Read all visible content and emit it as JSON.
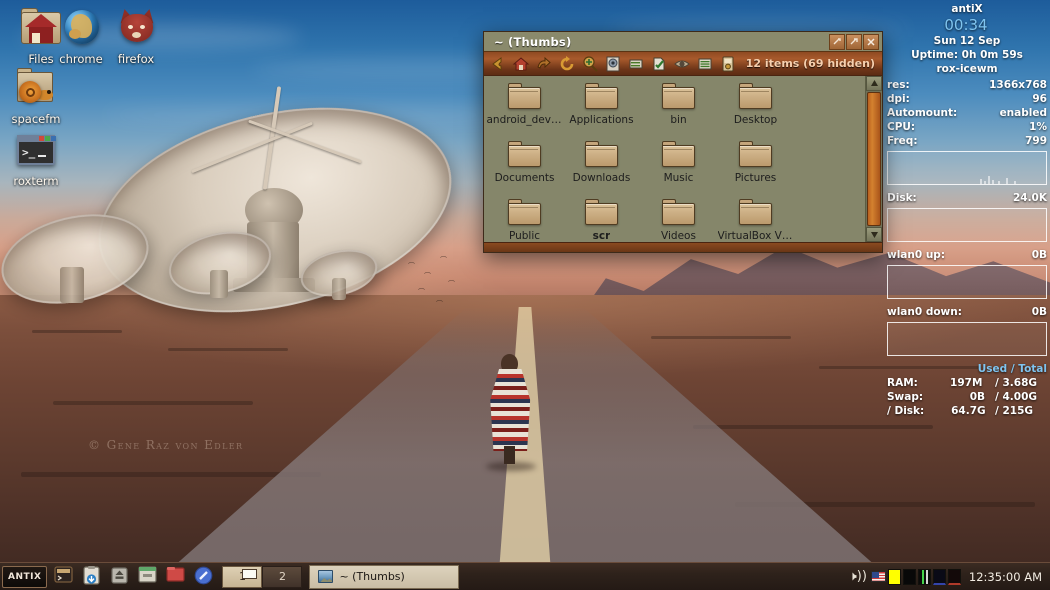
{
  "desktop": {
    "wallpaper_credit": "© Gene Raz von Edler",
    "icons": [
      {
        "name": "Files",
        "icon": "folder-home-icon"
      },
      {
        "name": "chrome",
        "icon": "globe-icon"
      },
      {
        "name": "firefox",
        "icon": "fox-head-icon"
      },
      {
        "name": "spacefm",
        "icon": "snail-box-icon"
      },
      {
        "name": "roxterm",
        "icon": "terminal-icon"
      }
    ]
  },
  "conky": {
    "distro": "antiX",
    "clock": "00:34",
    "date": "Sun 12 Sep",
    "uptime": "Uptime: 0h 0m 59s",
    "session": "rox-icewm",
    "stats": [
      {
        "label": "res:",
        "value": "1366x768"
      },
      {
        "label": "dpi:",
        "value": "96"
      },
      {
        "label": "Automount:",
        "value": "enabled"
      },
      {
        "label": "CPU:",
        "value": "1%"
      },
      {
        "label": "Freq:",
        "value": "799"
      }
    ],
    "meters": [
      {
        "label": "Disk:",
        "value": "24.0K"
      },
      {
        "label": "wlan0 up:",
        "value": "0B"
      },
      {
        "label": "wlan0 down:",
        "value": "0B"
      }
    ],
    "memory_header_used": "Used",
    "memory_header_sep": "/ Total",
    "memory": [
      {
        "label": "RAM:",
        "used": "197M",
        "total": "/ 3.68G"
      },
      {
        "label": "Swap:",
        "used": "0B",
        "total": "/ 4.00G"
      },
      {
        "label": "/ Disk:",
        "used": "64.7G",
        "total": "/ 215G"
      }
    ],
    "accent_color": "#7fc4ef",
    "text_color": "#ffffff"
  },
  "file_manager": {
    "title": "~ (Thumbs)",
    "status_count": "12 items (69 hidden)",
    "window_buttons": [
      {
        "name": "minimize-button",
        "glyph": "minimize"
      },
      {
        "name": "maximize-button",
        "glyph": "maximize"
      },
      {
        "name": "close-button",
        "glyph": "close"
      }
    ],
    "toolbar": [
      {
        "name": "back-button",
        "icon": "left-arrow-icon"
      },
      {
        "name": "home-button",
        "icon": "home-icon"
      },
      {
        "name": "up-button",
        "icon": "up-arrow-icon"
      },
      {
        "name": "refresh-button",
        "icon": "refresh-icon"
      },
      {
        "name": "zoom-button",
        "icon": "magnifier-plus-icon"
      },
      {
        "name": "details-button",
        "icon": "details-icon"
      },
      {
        "name": "sort-button",
        "icon": "sort-icon"
      },
      {
        "name": "select-button",
        "icon": "select-icon"
      },
      {
        "name": "hidden-button",
        "icon": "eye-icon"
      },
      {
        "name": "list-button",
        "icon": "list-icon"
      },
      {
        "name": "options-button",
        "icon": "options-icon"
      }
    ],
    "files": [
      {
        "name": "android_device",
        "bold": false
      },
      {
        "name": "Applications",
        "bold": false
      },
      {
        "name": "bin",
        "bold": false
      },
      {
        "name": "Desktop",
        "bold": false
      },
      {
        "name": "Documents",
        "bold": false
      },
      {
        "name": "Downloads",
        "bold": false
      },
      {
        "name": "Music",
        "bold": false
      },
      {
        "name": "Pictures",
        "bold": false
      },
      {
        "name": "Public",
        "bold": false
      },
      {
        "name": "scr",
        "bold": true
      },
      {
        "name": "Videos",
        "bold": false
      },
      {
        "name": "VirtualBox VMs",
        "bold": false
      }
    ],
    "scroll_up": "▲",
    "scroll_down": "▼",
    "title_color": "#c0783c",
    "background_color": "#85866a"
  },
  "taskbar": {
    "menu_label": "ANTIX",
    "launchers": [
      {
        "name": "terminal-launcher",
        "icon": "terminal-icon"
      },
      {
        "name": "installer-launcher",
        "icon": "package-down-icon"
      },
      {
        "name": "eject-launcher",
        "icon": "eject-icon"
      },
      {
        "name": "window-launcher",
        "icon": "window-icon"
      },
      {
        "name": "files-launcher",
        "icon": "folder-icon"
      },
      {
        "name": "browser-launcher",
        "icon": "browser-icon"
      }
    ],
    "desktops": [
      {
        "label": "1",
        "active": true
      },
      {
        "label": "2",
        "active": false
      }
    ],
    "tasks": [
      {
        "label": "~ (Thumbs)",
        "icon": "image-icon",
        "active": true
      }
    ],
    "tray": [
      {
        "name": "volume-icon",
        "glyph": "speaker"
      },
      {
        "name": "keyboard-flag-icon",
        "glyph": "flag-us"
      },
      {
        "name": "cpu-monitor-icon",
        "color": "#ffff00"
      },
      {
        "name": "net-monitor-icon",
        "color": "#0a0a0a"
      },
      {
        "name": "mem-monitor-icon",
        "color": "#0f2a0f"
      },
      {
        "name": "swap-monitor-icon",
        "color": "#0a0a18"
      },
      {
        "name": "disk-monitor-icon",
        "color": "#160a0a"
      }
    ],
    "clock": "12:35:00 AM"
  }
}
